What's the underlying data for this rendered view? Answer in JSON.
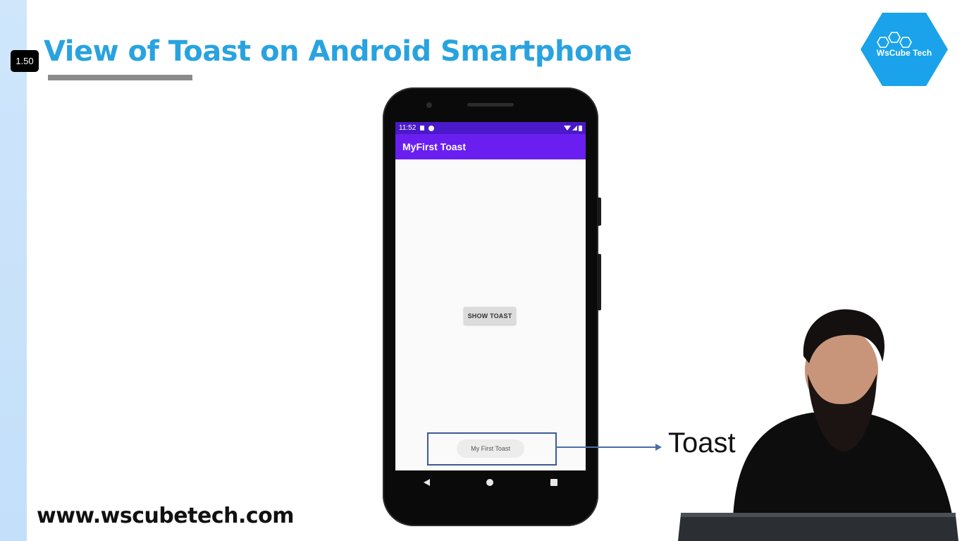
{
  "slide": {
    "title": "View of Toast on Android Smartphone",
    "website": "www.wscubetech.com",
    "callout_label": "Toast"
  },
  "player": {
    "speed_badge": "1.50"
  },
  "logo": {
    "text": "WsCube Tech",
    "color": "#1aa3ea"
  },
  "phone": {
    "status_time": "11:52",
    "app_title": "MyFirst Toast",
    "button_label": "SHOW TOAST",
    "toast_message": "My First Toast",
    "nav": [
      "back-icon",
      "home-icon",
      "recents-icon"
    ]
  },
  "colors": {
    "title": "#29a3df",
    "appbar": "#6a1ff0",
    "statusbar": "#4a19c9",
    "highlight": "#3d5a99"
  }
}
